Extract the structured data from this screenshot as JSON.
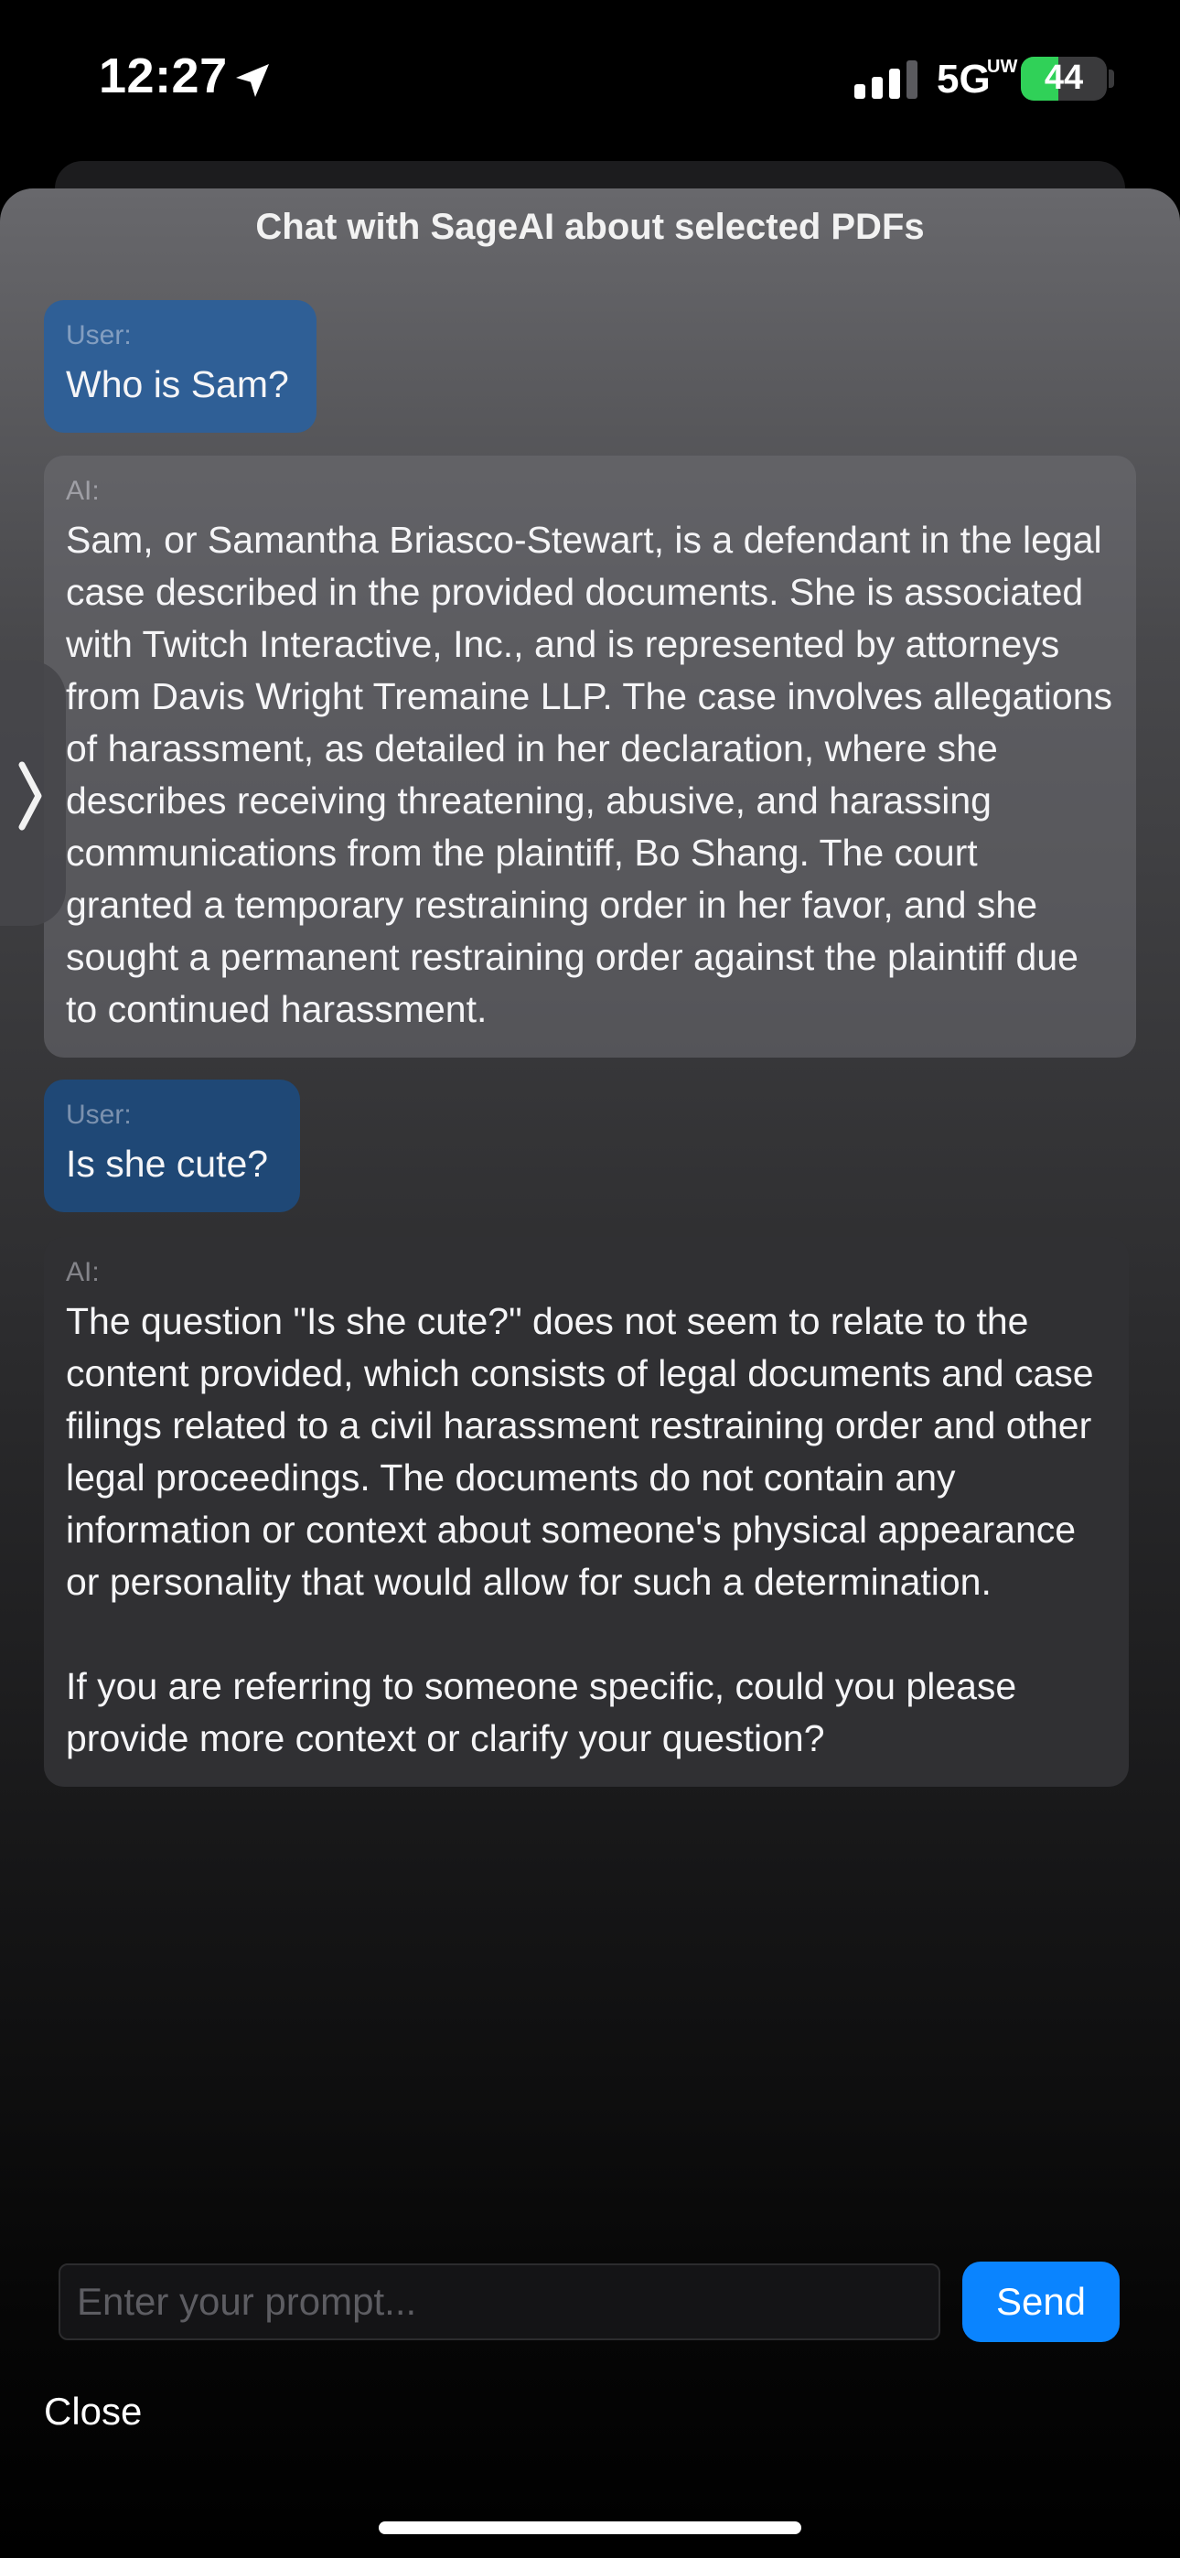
{
  "status_bar": {
    "time": "12:27",
    "network": "5G",
    "network_sub": "UW",
    "battery_percent": 44,
    "battery_text": "44",
    "icons": [
      "location-arrow-icon",
      "signal-bars-icon",
      "battery-charging-icon"
    ]
  },
  "sheet": {
    "title": "Chat with SageAI about selected PDFs"
  },
  "messages": [
    {
      "role": "user",
      "label": "User:",
      "text": "Who is Sam?"
    },
    {
      "role": "ai",
      "label": "AI:",
      "text": "Sam, or Samantha Briasco-Stewart, is a defendant in the legal case described in the provided documents. She is associated with Twitch Interactive, Inc., and is represented by attorneys from Davis Wright Tremaine LLP. The case involves allegations of harassment, as detailed in her declaration, where she describes receiving threatening, abusive, and harassing communications from the plaintiff, Bo Shang. The court granted a temporary restraining order in her favor, and she sought a permanent restraining order against the plaintiff due to continued harassment."
    },
    {
      "role": "user",
      "label": "User:",
      "text": "Is she cute?"
    },
    {
      "role": "ai",
      "label": "AI:",
      "text": "The question \"Is she cute?\" does not seem to relate to the content provided, which consists of legal documents and case filings related to a civil harassment restraining order and other legal proceedings. The documents do not contain any information or context about someone's physical appearance or personality that would allow for such a determination.\n\nIf you are referring to someone specific, could you please provide more context or clarify your question?"
    }
  ],
  "input": {
    "placeholder": "Enter your prompt...",
    "value": ""
  },
  "send_label": "Send",
  "close_label": "Close",
  "colors": {
    "accent": "#0a84ff",
    "user_bubble": "#2f5f96",
    "battery": "#30d158"
  }
}
